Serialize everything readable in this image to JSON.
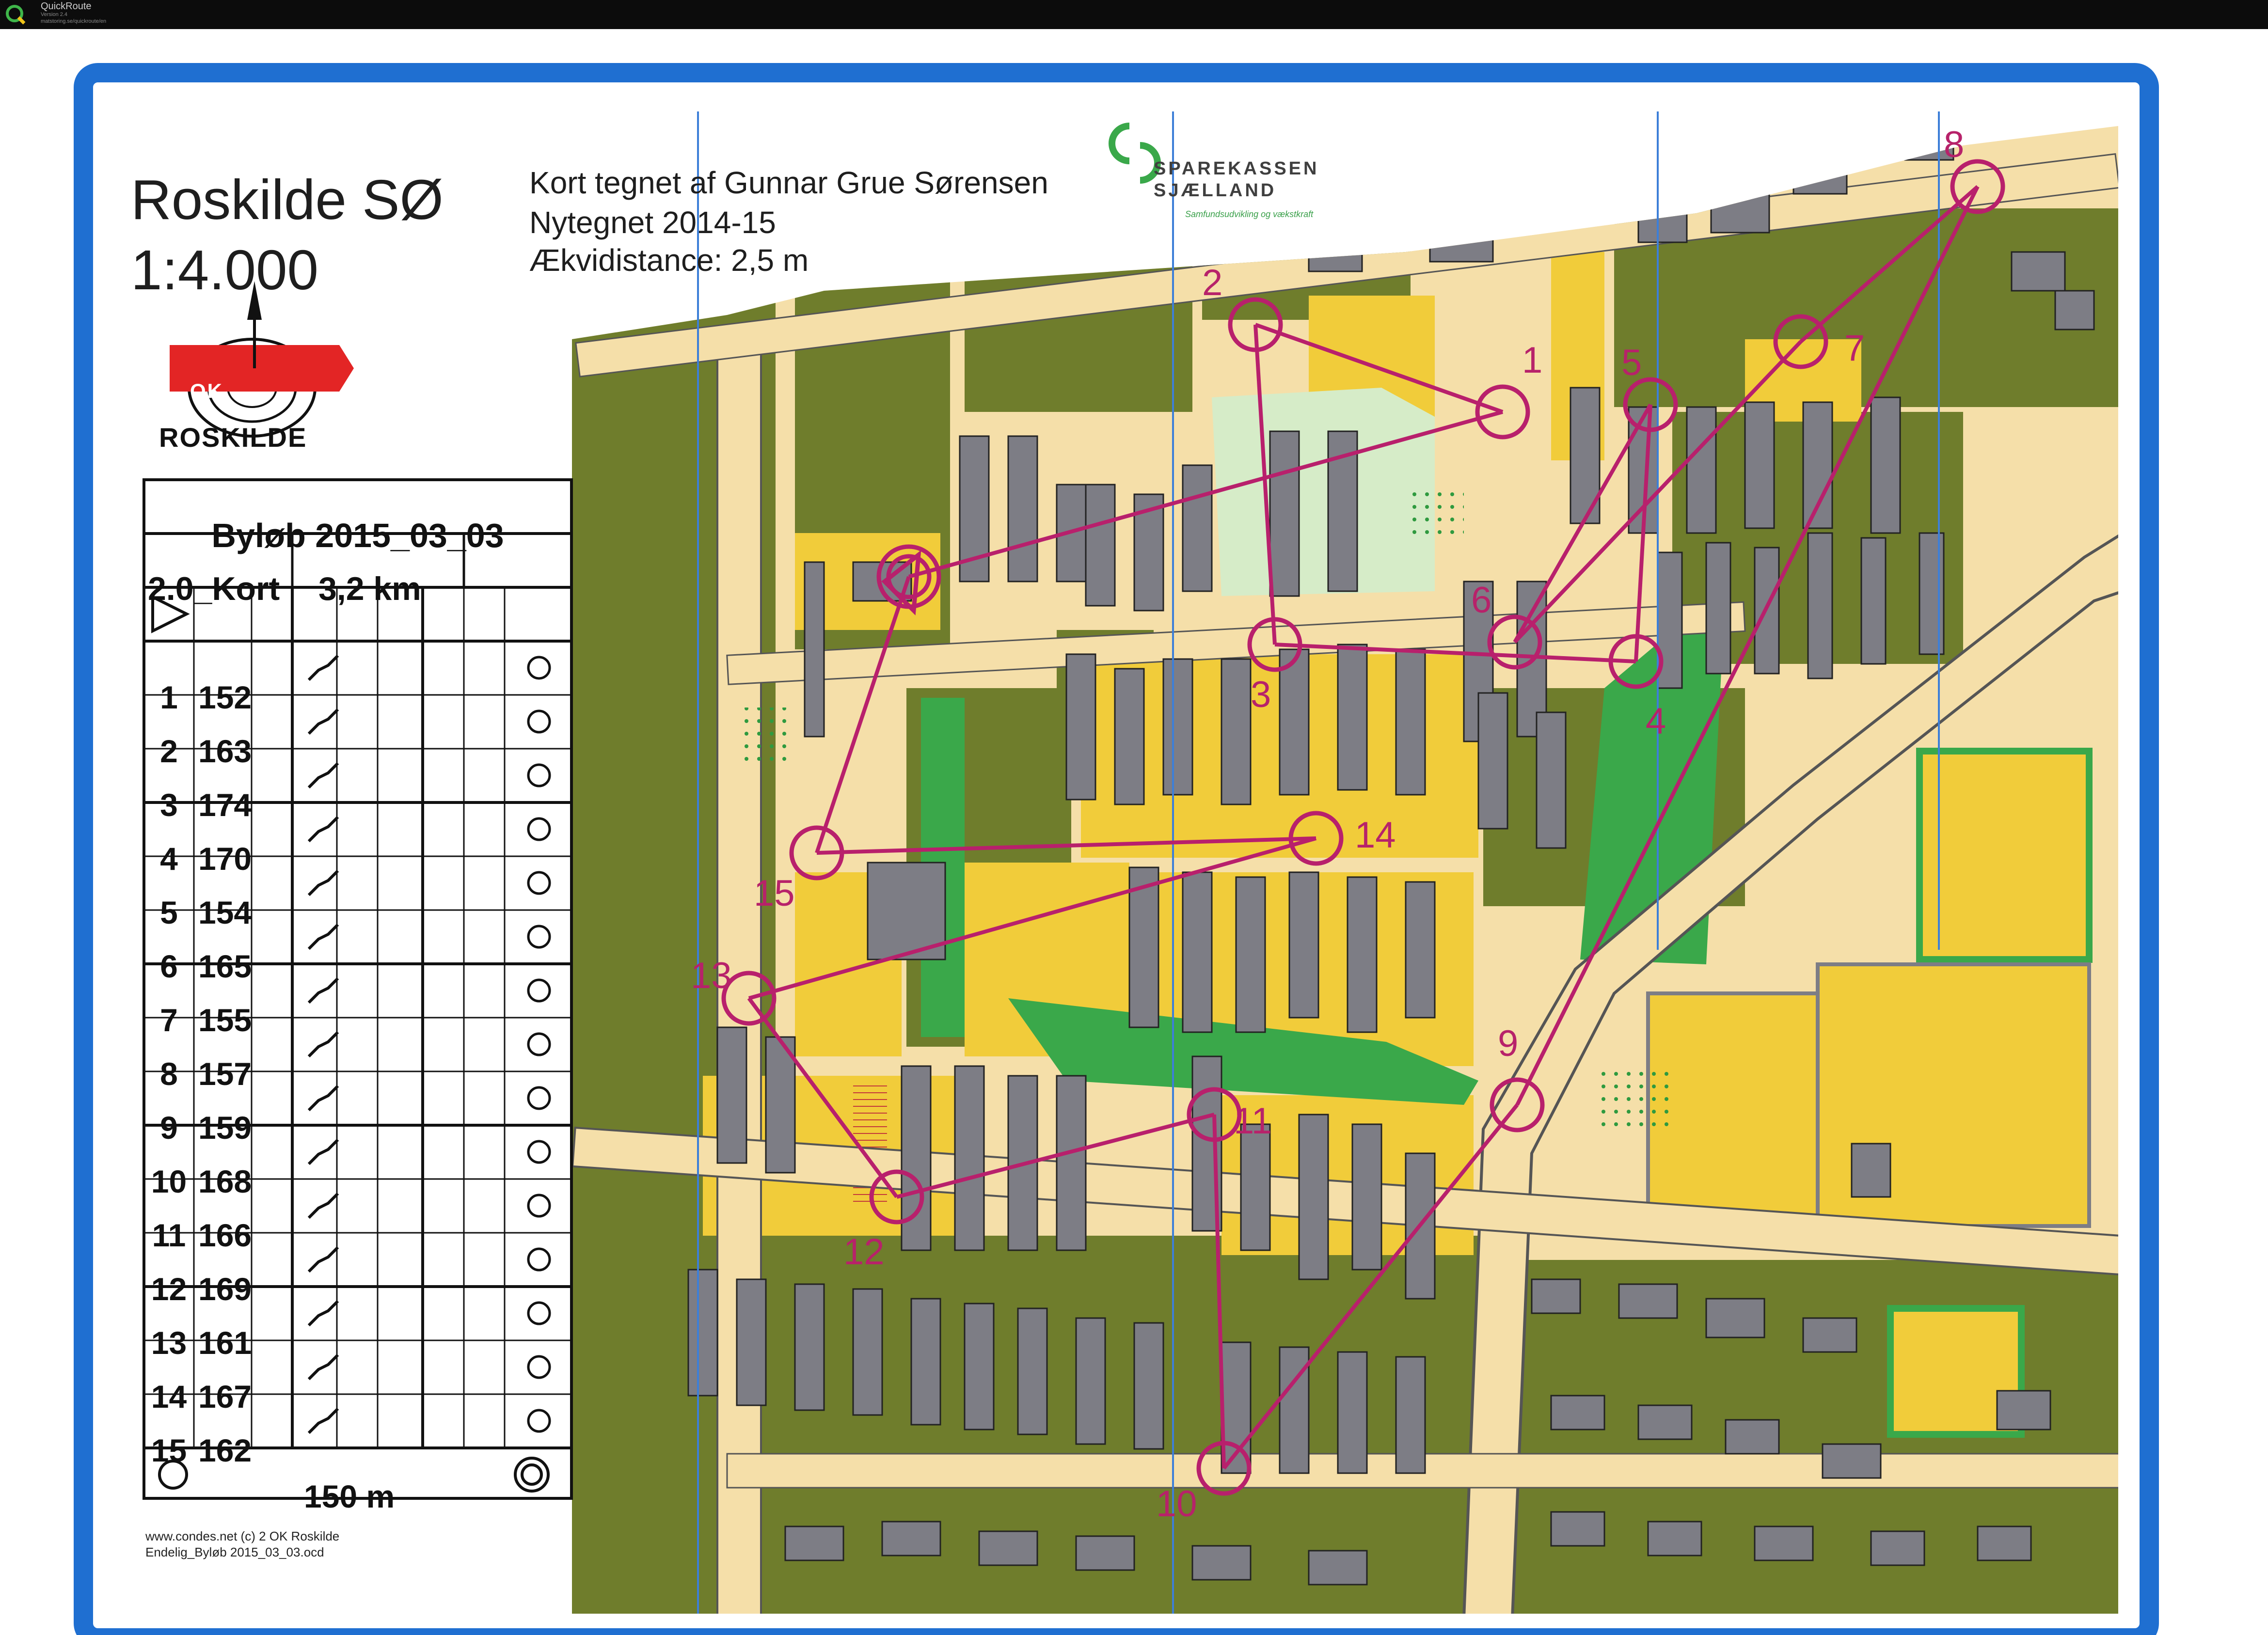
{
  "window": {
    "app_name": "QuickRoute",
    "subtitle_line1": "Version 2.4",
    "subtitle_line2": "matstoring.se/quickroute/en"
  },
  "map": {
    "name": "Roskilde SØ",
    "scale": "1:4.000",
    "credit_drawn": "Kort tegnet af Gunnar Grue Sørensen",
    "credit_updated": "Nytegnet 2014-15",
    "credit_equidistance": "Ækvidistance: 2,5 m",
    "sponsor_line1": "SPAREKASSEN",
    "sponsor_line2": "SJÆLLAND",
    "sponsor_tagline": "Samfundsudvikling og vækstkraft",
    "club_logo_text": "OK",
    "club_name": "ROSKILDE",
    "footer_line1": "www.condes.net (c) 2 OK Roskilde",
    "footer_line2": "Endelig_Byløb 2015_03_03.ocd",
    "colors": {
      "course": "#b8206c",
      "olive": "#6f7d2c",
      "yellow": "#f1cc3a",
      "paved": "#f5dfa9",
      "building": "#7d7d85",
      "green": "#3aa84a",
      "frame": "#1f6fd1"
    }
  },
  "description_sheet": {
    "title": "Byløb 2015_03_03",
    "class": "2.0_Kort",
    "length": "3,2 km",
    "start_symbol": "start-triangle",
    "rows": [
      {
        "num": "1",
        "code": "152"
      },
      {
        "num": "2",
        "code": "163"
      },
      {
        "num": "3",
        "code": "174"
      },
      {
        "num": "4",
        "code": "170"
      },
      {
        "num": "5",
        "code": "154"
      },
      {
        "num": "6",
        "code": "165"
      },
      {
        "num": "7",
        "code": "155"
      },
      {
        "num": "8",
        "code": "157"
      },
      {
        "num": "9",
        "code": "159"
      },
      {
        "num": "10",
        "code": "168"
      },
      {
        "num": "11",
        "code": "166"
      },
      {
        "num": "12",
        "code": "169"
      },
      {
        "num": "13",
        "code": "161"
      },
      {
        "num": "14",
        "code": "167"
      },
      {
        "num": "15",
        "code": "162"
      }
    ],
    "finish_distance": "150 m"
  },
  "course": {
    "controls": [
      {
        "label": "1"
      },
      {
        "label": "2"
      },
      {
        "label": "3"
      },
      {
        "label": "4"
      },
      {
        "label": "5"
      },
      {
        "label": "6"
      },
      {
        "label": "7"
      },
      {
        "label": "8"
      },
      {
        "label": "9"
      },
      {
        "label": "10"
      },
      {
        "label": "11"
      },
      {
        "label": "12"
      },
      {
        "label": "13"
      },
      {
        "label": "14"
      },
      {
        "label": "15"
      }
    ]
  }
}
